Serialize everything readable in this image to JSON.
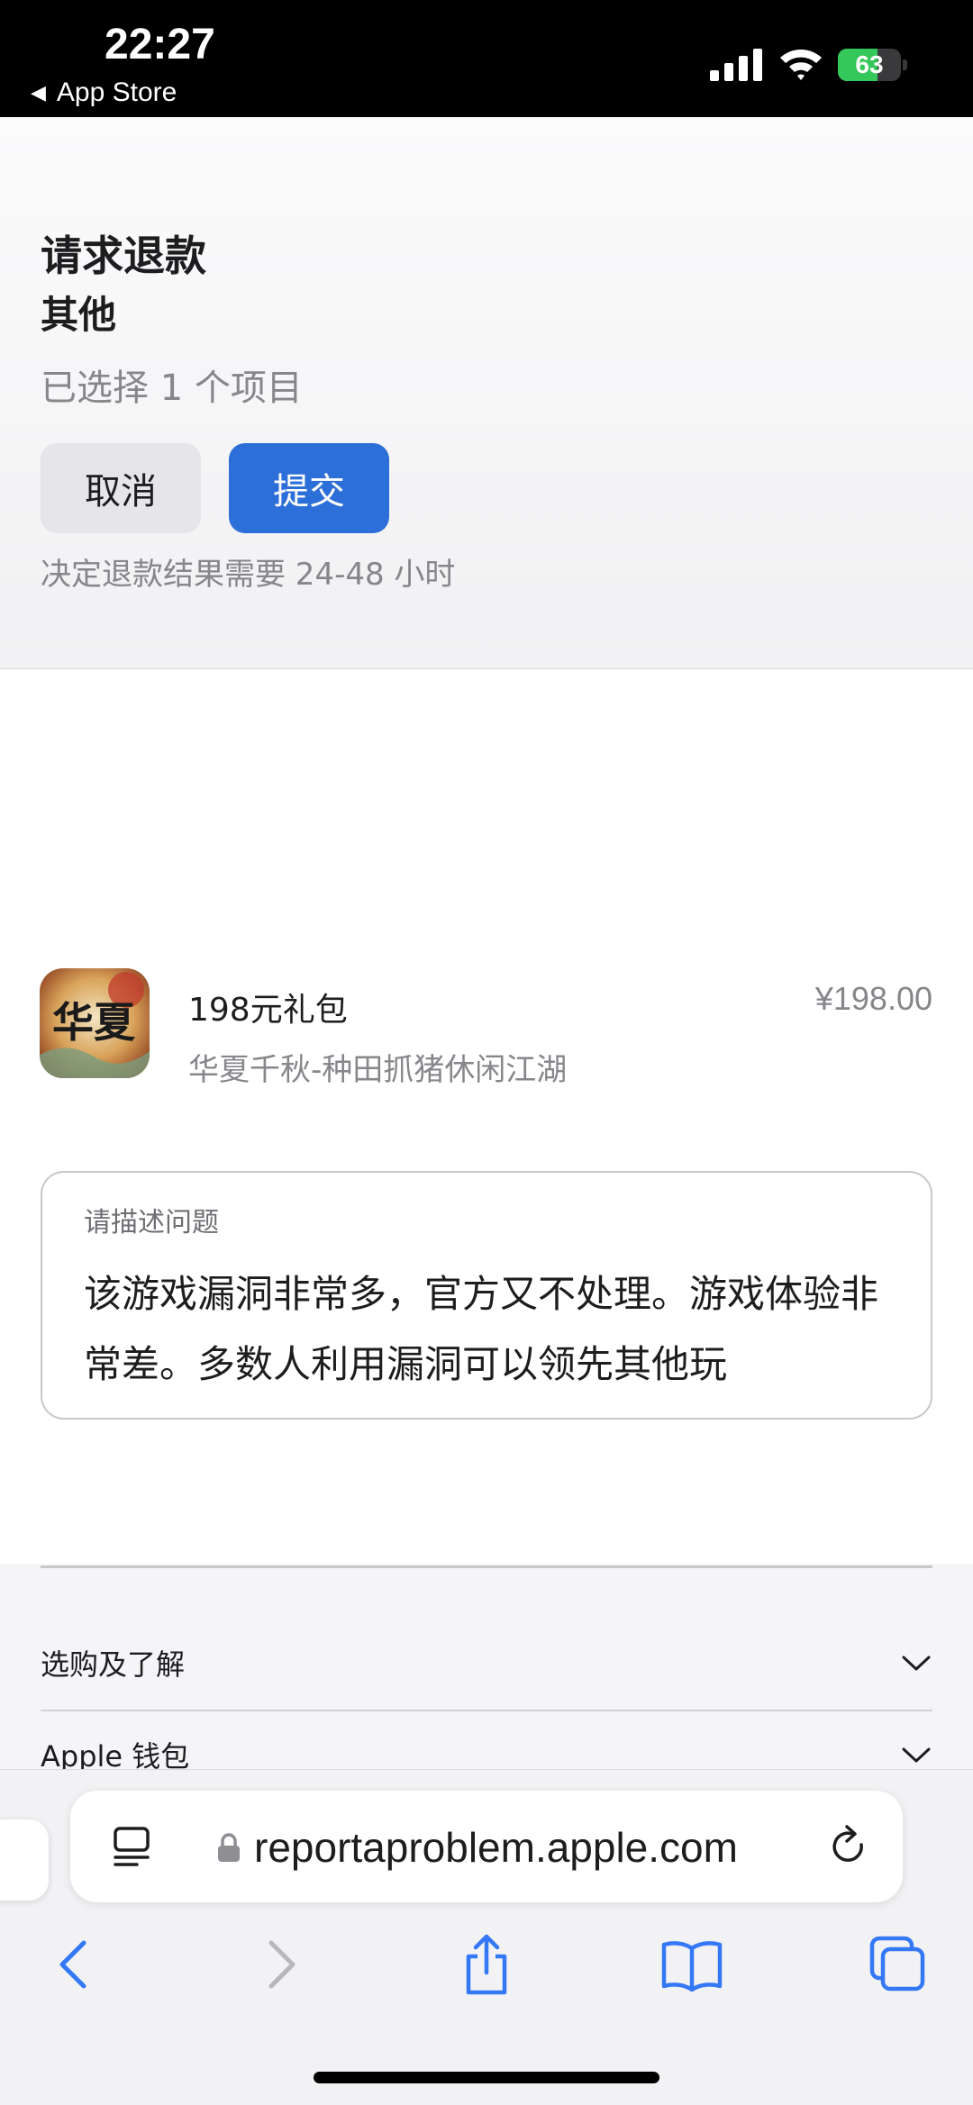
{
  "status_bar": {
    "time": "22:27",
    "back_app": "App Store",
    "battery": "63",
    "battery_level": 0.63
  },
  "header": {
    "title": "请求退款",
    "subtitle": "其他",
    "selected_count": "已选择 1 个项目",
    "cancel_label": "取消",
    "submit_label": "提交",
    "note": "决定退款结果需要 24-48 小时"
  },
  "product": {
    "name": "198元礼包",
    "app_name": "华夏千秋-种田抓猪休闲江湖",
    "price": "¥198.00",
    "icon_text": "华夏"
  },
  "description": {
    "label": "请描述问题",
    "text": "该游戏漏洞非常多，官方又不处理。游戏体验非常差。多数人利用漏洞可以领先其他玩"
  },
  "footer": {
    "items": [
      {
        "label": "选购及了解"
      },
      {
        "label": "Apple 钱包"
      }
    ]
  },
  "browser": {
    "url": "reportaproblem.apple.com"
  },
  "colors": {
    "accent": "#2d6fd8",
    "toolbar_icon": "#3478f6",
    "battery_green": "#34c759"
  }
}
